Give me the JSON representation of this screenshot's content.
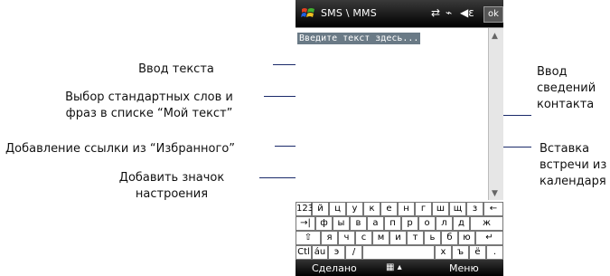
{
  "device": {
    "title": "SMS \\ MMS",
    "ok_label": "ok",
    "placeholder": "Введите текст здесь...",
    "softkey_left": "Сделано",
    "softkey_right": "Меню",
    "keyboard_rows": [
      [
        "123",
        "й",
        "ц",
        "у",
        "к",
        "е",
        "н",
        "г",
        "ш",
        "щ",
        "з",
        "←"
      ],
      [
        "→|",
        "ф",
        "ы",
        "в",
        "а",
        "п",
        "р",
        "о",
        "л",
        "д",
        "ж"
      ],
      [
        "⇧",
        "я",
        "ч",
        "с",
        "м",
        "и",
        "т",
        "ь",
        "б",
        "ю",
        "↵"
      ],
      [
        "Ctl",
        "áu",
        "э",
        "/",
        "",
        "х",
        "ъ",
        "ё",
        "."
      ]
    ]
  },
  "annotations": {
    "text_input": "Ввод текста",
    "standard_words_line1": "Выбор стандартных слов и",
    "standard_words_line2": "фраз в списке “Мой текст”",
    "add_favorites": "Добавление ссылки из “Избранного”",
    "mood_icon_line1": "Добавить значок",
    "mood_icon_line2": "настроения",
    "contact_line1": "Ввод",
    "contact_line2": "сведений",
    "contact_line3": "контакта",
    "calendar_line1": "Вставка",
    "calendar_line2": "встречи из",
    "calendar_line3": "календаря"
  }
}
